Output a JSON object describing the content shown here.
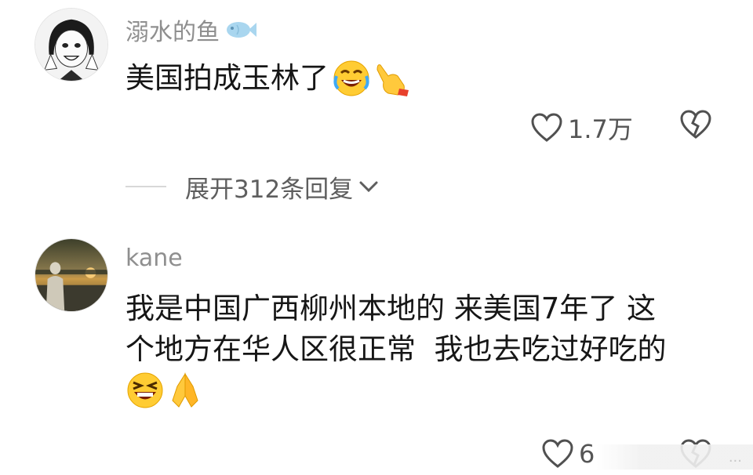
{
  "comments": [
    {
      "username": "溺水的鱼",
      "text": "美国拍成玉林了",
      "likes": "1.7万"
    },
    {
      "username": "kane",
      "text_line1": "我是中国广西柳州本地的 来美国7年了 这",
      "text_line2": "个地方在华人区很正常  我也去吃过好吃的",
      "likes": "6"
    }
  ],
  "expand_replies_label": "展开312条回复",
  "watermark": "...",
  "icons": {
    "username_badge": "fish-icon",
    "comment1_emojis": [
      "rofl-emoji-icon",
      "pointing-hand-emoji-icon"
    ],
    "comment2_emojis": [
      "laughing-emoji-icon",
      "praying-hands-emoji-icon"
    ],
    "like": "heart-outline-icon",
    "dislike": "broken-heart-icon",
    "expand": "chevron-down-icon"
  },
  "colors": {
    "text": "#161616",
    "username": "#8f8f8f",
    "secondary": "#5e5e5e"
  }
}
